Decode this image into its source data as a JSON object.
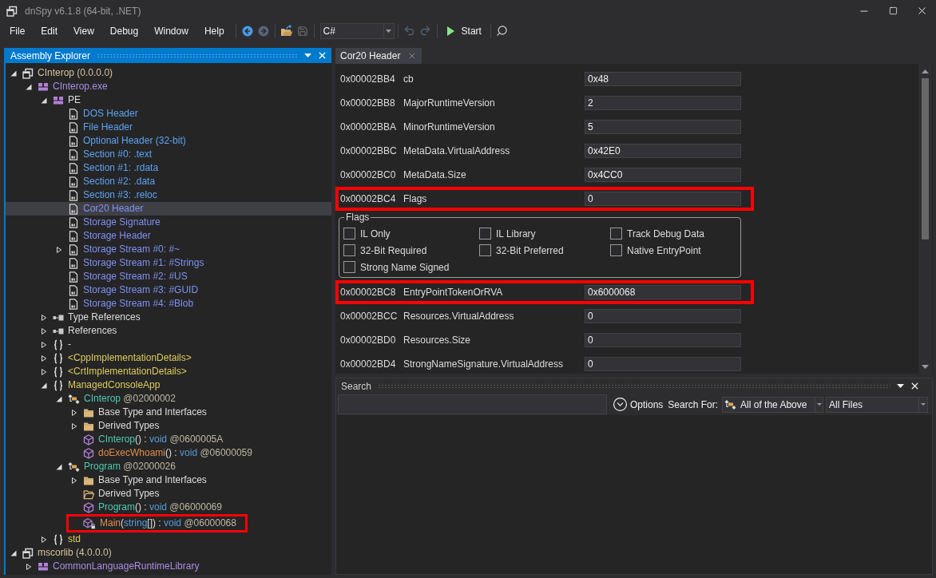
{
  "window": {
    "title": "dnSpy v6.1.8 (64-bit, .NET)"
  },
  "menu": [
    "File",
    "Edit",
    "View",
    "Debug",
    "Window",
    "Help"
  ],
  "toolbar": [
    {
      "kind": "separator"
    },
    {
      "kind": "back",
      "disabled": false
    },
    {
      "kind": "forward",
      "disabled": true
    },
    {
      "kind": "separator"
    },
    {
      "kind": "open",
      "disabled": false
    },
    {
      "kind": "save",
      "disabled": true
    },
    {
      "kind": "separator"
    },
    {
      "kind": "language",
      "value": "C#"
    },
    {
      "kind": "separator"
    },
    {
      "kind": "undo",
      "disabled": true
    },
    {
      "kind": "redo",
      "disabled": true
    },
    {
      "kind": "separator"
    },
    {
      "kind": "start",
      "label": "Start",
      "disabled": false
    },
    {
      "kind": "separator"
    },
    {
      "kind": "search",
      "disabled": false
    }
  ],
  "assembly_explorer": {
    "title": "Assembly Explorer",
    "tree": [
      {
        "kind": "assembly",
        "label": "CInterop (0.0.0.0)",
        "expanded": true,
        "selected": false,
        "highlighted": false,
        "children": [
          {
            "kind": "module",
            "label": "CInterop.exe",
            "expanded": true,
            "selected": false,
            "highlighted": false,
            "children": [
              {
                "kind": "pe",
                "label": "PE",
                "expanded": true,
                "selected": false,
                "highlighted": false,
                "children": [
                  {
                    "kind": "header",
                    "label": "DOS Header",
                    "selected": false,
                    "highlighted": false
                  },
                  {
                    "kind": "header",
                    "label": "File Header",
                    "selected": false,
                    "highlighted": false
                  },
                  {
                    "kind": "header",
                    "label": "Optional Header (32-bit)",
                    "selected": false,
                    "highlighted": false
                  },
                  {
                    "kind": "header",
                    "label": "Section #0: .text",
                    "selected": false,
                    "highlighted": false
                  },
                  {
                    "kind": "header",
                    "label": "Section #1: .rdata",
                    "selected": false,
                    "highlighted": false
                  },
                  {
                    "kind": "header",
                    "label": "Section #2: .data",
                    "selected": false,
                    "highlighted": false
                  },
                  {
                    "kind": "header",
                    "label": "Section #3: .reloc",
                    "selected": false,
                    "highlighted": false
                  },
                  {
                    "kind": "metadata",
                    "label": "Cor20 Header",
                    "selected": true,
                    "highlighted": false
                  },
                  {
                    "kind": "metadata",
                    "label": "Storage Signature",
                    "selected": false,
                    "highlighted": false
                  },
                  {
                    "kind": "metadata",
                    "label": "Storage Header",
                    "selected": false,
                    "highlighted": false
                  },
                  {
                    "kind": "metadata",
                    "label": "Storage Stream #0: #~",
                    "expanded": false,
                    "selected": false,
                    "highlighted": false
                  },
                  {
                    "kind": "metadata",
                    "label": "Storage Stream #1: #Strings",
                    "selected": false,
                    "highlighted": false
                  },
                  {
                    "kind": "metadata",
                    "label": "Storage Stream #2: #US",
                    "selected": false,
                    "highlighted": false
                  },
                  {
                    "kind": "metadata",
                    "label": "Storage Stream #3: #GUID",
                    "selected": false,
                    "highlighted": false
                  },
                  {
                    "kind": "metadata",
                    "label": "Storage Stream #4: #Blob",
                    "selected": false,
                    "highlighted": false
                  }
                ]
              },
              {
                "kind": "references",
                "label": "Type References",
                "expanded": false,
                "selected": false,
                "highlighted": false
              },
              {
                "kind": "references",
                "label": "References",
                "expanded": false,
                "selected": false,
                "highlighted": false
              },
              {
                "kind": "namespace",
                "label_parts": [
                  {
                    "text": "-",
                    "kind": "plain"
                  }
                ],
                "expanded": false,
                "selected": false,
                "highlighted": false
              },
              {
                "kind": "namespace",
                "label": "<CppImplementationDetails>",
                "expanded": false,
                "selected": false,
                "highlighted": false
              },
              {
                "kind": "namespace",
                "label": "<CrtImplementationDetails>",
                "expanded": false,
                "selected": false,
                "highlighted": false
              },
              {
                "kind": "namespace",
                "label": "ManagedConsoleApp",
                "expanded": true,
                "selected": false,
                "highlighted": false,
                "children": [
                  {
                    "kind": "class",
                    "label_parts": [
                      {
                        "text": "CInterop",
                        "kind": "type"
                      },
                      {
                        "text": " @02000002",
                        "kind": "token"
                      }
                    ],
                    "expanded": true,
                    "selected": false,
                    "highlighted": false,
                    "children": [
                      {
                        "kind": "folder",
                        "label": "Base Type and Interfaces",
                        "expanded": false,
                        "selected": false,
                        "highlighted": false
                      },
                      {
                        "kind": "folder",
                        "label": "Derived Types",
                        "expanded": false,
                        "selected": false,
                        "highlighted": false
                      },
                      {
                        "kind": "method",
                        "label_parts": [
                          {
                            "text": "CInterop",
                            "kind": "type"
                          },
                          {
                            "text": "() : ",
                            "kind": "plain"
                          },
                          {
                            "text": "void",
                            "kind": "keyword"
                          },
                          {
                            "text": " @0600005A",
                            "kind": "token"
                          }
                        ],
                        "selected": false,
                        "highlighted": false
                      },
                      {
                        "kind": "method",
                        "label_parts": [
                          {
                            "text": "doExecWhoami",
                            "kind": "method"
                          },
                          {
                            "text": "() : ",
                            "kind": "plain"
                          },
                          {
                            "text": "void",
                            "kind": "keyword"
                          },
                          {
                            "text": " @06000059",
                            "kind": "token"
                          }
                        ],
                        "selected": false,
                        "highlighted": false
                      }
                    ]
                  },
                  {
                    "kind": "class",
                    "label_parts": [
                      {
                        "text": "Program",
                        "kind": "type"
                      },
                      {
                        "text": " @02000026",
                        "kind": "token"
                      }
                    ],
                    "expanded": true,
                    "selected": false,
                    "highlighted": false,
                    "children": [
                      {
                        "kind": "folder",
                        "label": "Base Type and Interfaces",
                        "expanded": false,
                        "selected": false,
                        "highlighted": false
                      },
                      {
                        "kind": "empty-folder",
                        "label": "Derived Types",
                        "selected": false,
                        "highlighted": false
                      },
                      {
                        "kind": "method",
                        "label_parts": [
                          {
                            "text": "Program",
                            "kind": "type"
                          },
                          {
                            "text": "() : ",
                            "kind": "plain"
                          },
                          {
                            "text": "void",
                            "kind": "keyword"
                          },
                          {
                            "text": " @06000069",
                            "kind": "token"
                          }
                        ],
                        "selected": false,
                        "highlighted": false
                      },
                      {
                        "kind": "locked-method",
                        "label_parts": [
                          {
                            "text": "Main",
                            "kind": "method"
                          },
                          {
                            "text": "(",
                            "kind": "plain"
                          },
                          {
                            "text": "string",
                            "kind": "keyword"
                          },
                          {
                            "text": "[]) : ",
                            "kind": "plain"
                          },
                          {
                            "text": "void",
                            "kind": "keyword"
                          },
                          {
                            "text": " @06000068",
                            "kind": "token"
                          }
                        ],
                        "selected": false,
                        "highlighted": true
                      }
                    ]
                  }
                ]
              },
              {
                "kind": "namespace",
                "label": "std",
                "expanded": false,
                "selected": false,
                "highlighted": false
              }
            ]
          }
        ]
      },
      {
        "kind": "assembly",
        "label": "mscorlib (4.0.0.0)",
        "expanded": true,
        "selected": false,
        "highlighted": false,
        "children": [
          {
            "kind": "module",
            "label": "CommonLanguageRuntimeLibrary",
            "expanded": false,
            "selected": false,
            "highlighted": false
          }
        ]
      }
    ]
  },
  "document_tabs": [
    {
      "label": "Cor20 Header",
      "selected": true
    }
  ],
  "cor20_header": {
    "rows": [
      {
        "kind": "field",
        "address": "0x00002BB4",
        "name": "cb",
        "value": "0x48",
        "highlighted": false
      },
      {
        "kind": "field",
        "address": "0x00002BB8",
        "name": "MajorRuntimeVersion",
        "value": "2",
        "highlighted": false
      },
      {
        "kind": "field",
        "address": "0x00002BBA",
        "name": "MinorRuntimeVersion",
        "value": "5",
        "highlighted": false
      },
      {
        "kind": "field",
        "address": "0x00002BBC",
        "name": "MetaData.VirtualAddress",
        "value": "0x42E0",
        "highlighted": false
      },
      {
        "kind": "field",
        "address": "0x00002BC0",
        "name": "MetaData.Size",
        "value": "0x4CC0",
        "highlighted": false
      },
      {
        "kind": "field",
        "address": "0x00002BC4",
        "name": "Flags",
        "value": "0",
        "highlighted": true
      },
      {
        "kind": "flags",
        "title": "Flags",
        "options": [
          {
            "label": "IL Only",
            "checked": false
          },
          {
            "label": "IL Library",
            "checked": false
          },
          {
            "label": "Track Debug Data",
            "checked": false
          },
          {
            "label": "32-Bit Required",
            "checked": false
          },
          {
            "label": "32-Bit Preferred",
            "checked": false
          },
          {
            "label": "Native EntryPoint",
            "checked": false
          },
          {
            "label": "Strong Name Signed",
            "checked": false
          }
        ]
      },
      {
        "kind": "field",
        "address": "0x00002BC8",
        "name": "EntryPointTokenOrRVA",
        "value": "0x6000068",
        "highlighted": true
      },
      {
        "kind": "field",
        "address": "0x00002BCC",
        "name": "Resources.VirtualAddress",
        "value": "0",
        "highlighted": false
      },
      {
        "kind": "field",
        "address": "0x00002BD0",
        "name": "Resources.Size",
        "value": "0",
        "highlighted": false
      },
      {
        "kind": "field",
        "address": "0x00002BD4",
        "name": "StrongNameSignature.VirtualAddress",
        "value": "0",
        "highlighted": false
      }
    ]
  },
  "search_panel": {
    "title": "Search",
    "options_label": "Options",
    "search_for_label": "Search For:",
    "search_for": "All of the Above",
    "scope": "All Files"
  }
}
